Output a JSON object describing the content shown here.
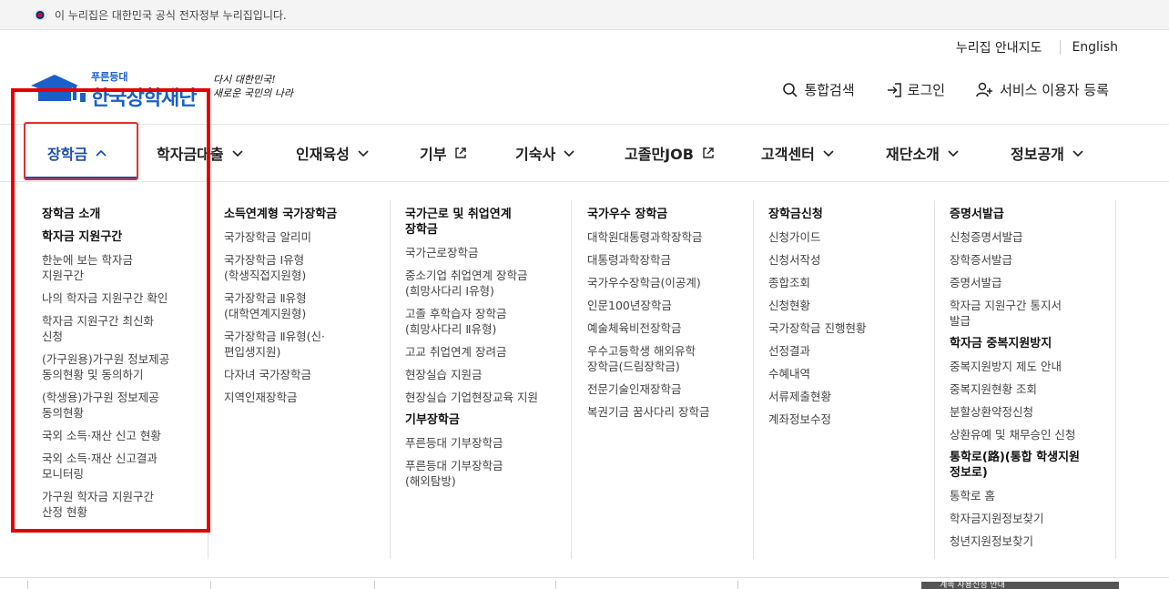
{
  "gov_bar": {
    "text": "이 누리집은 대한민국 공식 전자정부 누리집입니다."
  },
  "util": {
    "sitemap": "누리집 안내지도",
    "english": "English"
  },
  "logo": {
    "small": "푸른등대",
    "name": "한국장학재단",
    "slogan_line1": "다시 대한민국!",
    "slogan_line2": "새로운 국민의 나라"
  },
  "actions": {
    "search": "통합검색",
    "login": "로그인",
    "register": "서비스 이용자 등록"
  },
  "gnb": [
    {
      "label": "장학금",
      "icon": "chevron-up-icon"
    },
    {
      "label": "학자금대출",
      "icon": "chevron-down-icon"
    },
    {
      "label": "인재육성",
      "icon": "chevron-down-icon"
    },
    {
      "label": "기부",
      "icon": "external-link-icon"
    },
    {
      "label": "기숙사",
      "icon": "chevron-down-icon"
    },
    {
      "label": "고졸만JOB",
      "icon": "external-link-icon"
    },
    {
      "label": "고객센터",
      "icon": "chevron-down-icon"
    },
    {
      "label": "재단소개",
      "icon": "chevron-down-icon"
    },
    {
      "label": "정보공개",
      "icon": "chevron-down-icon"
    }
  ],
  "mega": {
    "col1": {
      "h1": "장학금 소개",
      "h2": "학자금 지원구간",
      "links": [
        "한눈에 보는 학자금\n지원구간",
        "나의 학자금 지원구간 확인",
        "학자금 지원구간 최신화\n신청",
        "(가구원용)가구원 정보제공\n동의현황 및 동의하기",
        "(학생용)가구원 정보제공\n동의현황",
        "국외 소득·재산 신고 현황",
        "국외 소득·재산 신고결과\n모니터링",
        "가구원 학자금 지원구간\n산정 현황"
      ]
    },
    "col2": {
      "h1": "소득연계형 국가장학금",
      "links": [
        "국가장학금 알리미",
        "국가장학금 Ⅰ유형\n(학생직접지원형)",
        "국가장학금 Ⅱ유형\n(대학연계지원형)",
        "국가장학금 Ⅱ유형(신·\n편입생지원)",
        "다자녀 국가장학금",
        "지역인재장학금"
      ]
    },
    "col3": {
      "h1": "국가근로 및 취업연계\n장학금",
      "links": [
        "국가근로장학금",
        "중소기업 취업연계 장학금\n(희망사다리 Ⅰ유형)",
        "고졸 후학습자 장학금\n(희망사다리 Ⅱ유형)",
        "고교 취업연계 장려금",
        "현장실습 지원금",
        "현장실습 기업현장교육 지원"
      ],
      "h2": "기부장학금",
      "links2": [
        "푸른등대 기부장학금",
        "푸른등대 기부장학금\n(해외탐방)"
      ]
    },
    "col4": {
      "h1": "국가우수 장학금",
      "links": [
        "대학원대통령과학장학금",
        "대통령과학장학금",
        "국가우수장학금(이공계)",
        "인문100년장학금",
        "예술체육비전장학금",
        "우수고등학생 해외유학\n장학금(드림장학금)",
        "전문기술인재장학금",
        "복권기금 꿈사다리 장학금"
      ]
    },
    "col5": {
      "h1": "장학금신청",
      "links": [
        "신청가이드",
        "신청서작성",
        "종합조회",
        "신청현황",
        "국가장학금 진행현황",
        "선정결과",
        "수혜내역",
        "서류제출현황",
        "계좌정보수정"
      ]
    },
    "col6": {
      "h1": "증명서발급",
      "links": [
        "신청증명서발급",
        "장학증서발급",
        "증명서발급",
        "학자금 지원구간 통지서\n발급"
      ],
      "h2": "학자금 중복지원방지",
      "links2": [
        "중복지원방지 제도 안내",
        "중복지원현황 조회",
        "분할상환약정신청",
        "상환유예 및 채무승인 신청"
      ],
      "h3": "통학로(路)(통합 학생지원\n정보로)",
      "links3": [
        "통학로 홈",
        "학자금지원정보찾기",
        "청년지원정보찾기"
      ]
    }
  },
  "bottom": {
    "banner": "계속 사용신청 안내"
  },
  "colors": {
    "accent": "#1b4fb0",
    "highlight": "#e50000"
  }
}
